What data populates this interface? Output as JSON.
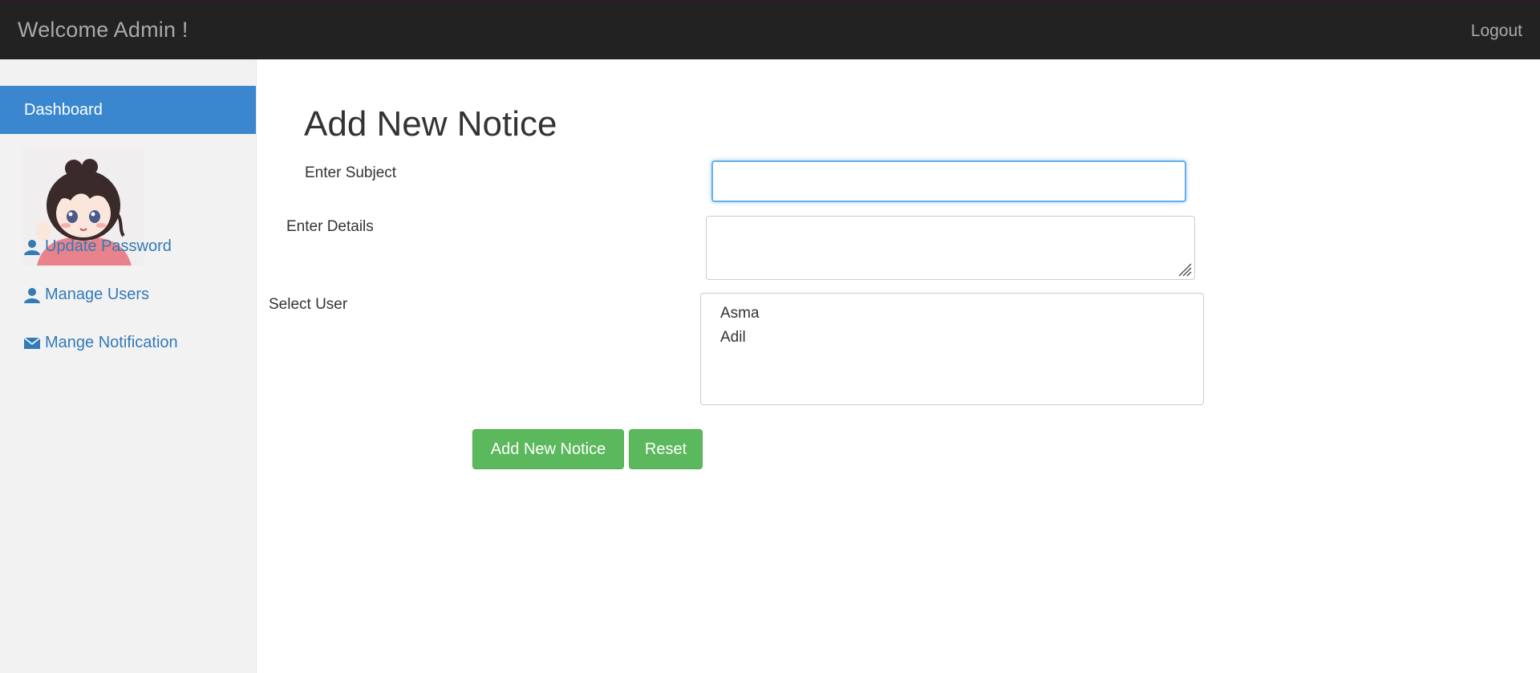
{
  "header": {
    "brand": "Welcome Admin !",
    "logout_label": "Logout"
  },
  "sidebar": {
    "active_item": "Dashboard",
    "links": [
      {
        "label": "Update Password",
        "icon": "user-icon"
      },
      {
        "label": "Manage Users",
        "icon": "user-icon"
      },
      {
        "label": "Mange Notification",
        "icon": "envelope-icon"
      }
    ]
  },
  "form": {
    "title": "Add New Notice",
    "subject_label": "Enter Subject",
    "subject_value": "",
    "details_label": "Enter Details",
    "details_value": "",
    "user_label": "Select User",
    "user_options": [
      "Asma",
      "Adil"
    ],
    "submit_label": "Add New Notice",
    "reset_label": "Reset"
  },
  "colors": {
    "topbar": "#222222",
    "sidebar_active": "#3a87cf",
    "link": "#337ab7",
    "button": "#5cb85c"
  }
}
